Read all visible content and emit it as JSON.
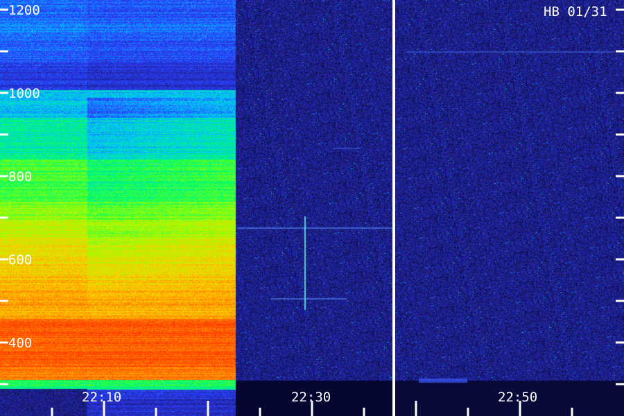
{
  "chart_data": {
    "type": "heatmap",
    "station_label": "HB 01/31",
    "x_tick_labels": [
      "22:10",
      "22:30",
      "22:50"
    ],
    "y_tick_labels": [
      "1200",
      "1000",
      "800",
      "600",
      "400"
    ],
    "y_tick_values": [
      1200,
      1000,
      800,
      600,
      400
    ],
    "ylim": [
      340,
      1240
    ],
    "xlabel": "",
    "ylabel": "",
    "colormap": [
      "#000020",
      "#20208a",
      "#2a3cff",
      "#00c8ff",
      "#00ff60",
      "#a0ff00",
      "#ffd000",
      "#ff6a00",
      "#ff1a00"
    ],
    "separator_color": "#ffffff"
  }
}
